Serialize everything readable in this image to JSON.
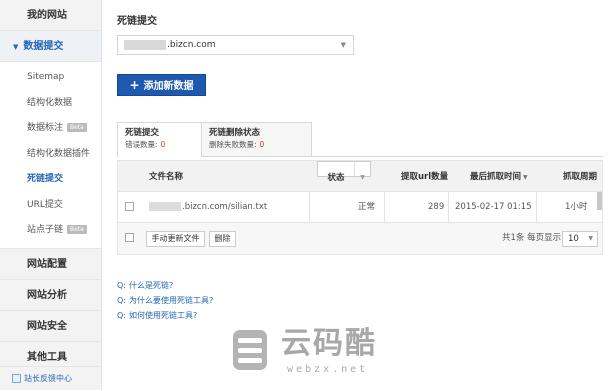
{
  "sidebar": {
    "groups": [
      {
        "label": "我的网站"
      },
      {
        "label": "数据提交",
        "expanded": true
      },
      {
        "label": "网站配置"
      },
      {
        "label": "网站分析"
      },
      {
        "label": "网站安全"
      },
      {
        "label": "其他工具"
      }
    ],
    "sub_items": [
      {
        "label": "Sitemap"
      },
      {
        "label": "结构化数据"
      },
      {
        "label": "数据标注",
        "badge": "Beta"
      },
      {
        "label": "结构化数据插件"
      },
      {
        "label": "死链提交",
        "active": true
      },
      {
        "label": "URL提交"
      },
      {
        "label": "站点子链",
        "badge": "Beta"
      }
    ],
    "footer": "站长反馈中心"
  },
  "main": {
    "title": "死链提交",
    "site_select": {
      "value_suffix": ".bizcn.com"
    },
    "add_button": "添加新数据",
    "tabs": [
      {
        "name": "死链提交",
        "count_label": "错误数量:",
        "count": "0"
      },
      {
        "name": "死链删除状态",
        "count_label": "删除失败数量:",
        "count": "0"
      }
    ],
    "table": {
      "headers": {
        "file_name": "文件名称",
        "status": "状态",
        "crawl_url_count": "提取url数量",
        "last_crawl_time": "最后抓取时间",
        "crawl_period": "抓取周期"
      },
      "rows": [
        {
          "file_suffix": ".bizcn.com/silian.txt",
          "status": "正常",
          "url_count": "289",
          "last_crawl": "2015-02-17 01:15",
          "period": "1小时"
        }
      ],
      "footer": {
        "manual_update": "手动更新文件",
        "delete": "删除",
        "pager_text": "共1条 每页显示:",
        "page_size": "10"
      }
    },
    "faq": [
      {
        "prefix": "Q:",
        "text": "什么是死链?"
      },
      {
        "prefix": "Q:",
        "text": "为什么要使用死链工具?"
      },
      {
        "prefix": "Q:",
        "text": "如何使用死链工具?"
      }
    ]
  },
  "watermark": {
    "text": "云码酷",
    "sub": "webzx.net"
  },
  "colors": {
    "accent": "#1e59b0",
    "link": "#2466b5",
    "error_count": "#d23b2c"
  }
}
